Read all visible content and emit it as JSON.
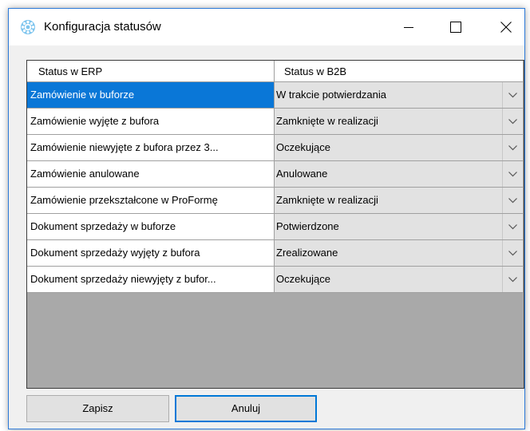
{
  "window": {
    "title": "Konfiguracja statusów",
    "icon": "gear-icon",
    "controls": [
      "minimize-icon",
      "maximize-icon",
      "close-icon"
    ]
  },
  "grid": {
    "columns": [
      "Status w ERP",
      "Status w B2B"
    ],
    "rows": [
      {
        "erp": "Zamówienie w buforze",
        "b2b": "W trakcie potwierdzania",
        "selected": true
      },
      {
        "erp": "Zamówienie wyjęte z bufora",
        "b2b": "Zamknięte w realizacji"
      },
      {
        "erp": "Zamówienie niewyjęte z bufora przez 3...",
        "b2b": "Oczekujące"
      },
      {
        "erp": "Zamówienie anulowane",
        "b2b": "Anulowane"
      },
      {
        "erp": "Zamówienie przekształcone w ProFormę",
        "b2b": "Zamknięte w realizacji"
      },
      {
        "erp": "Dokument sprzedaży w buforze",
        "b2b": "Potwierdzone"
      },
      {
        "erp": "Dokument sprzedaży wyjęty z bufora",
        "b2b": "Zrealizowane"
      },
      {
        "erp": "Dokument sprzedaży niewyjęty z bufor...",
        "b2b": "Oczekujące"
      }
    ]
  },
  "buttons": {
    "save_label": "Zapisz",
    "cancel_label": "Anuluj"
  },
  "colors": {
    "selection": "#0a77d7",
    "grid_background": "#a9a9a9",
    "combo_background": "#e2e2e2",
    "focus_border": "#0078d7"
  }
}
